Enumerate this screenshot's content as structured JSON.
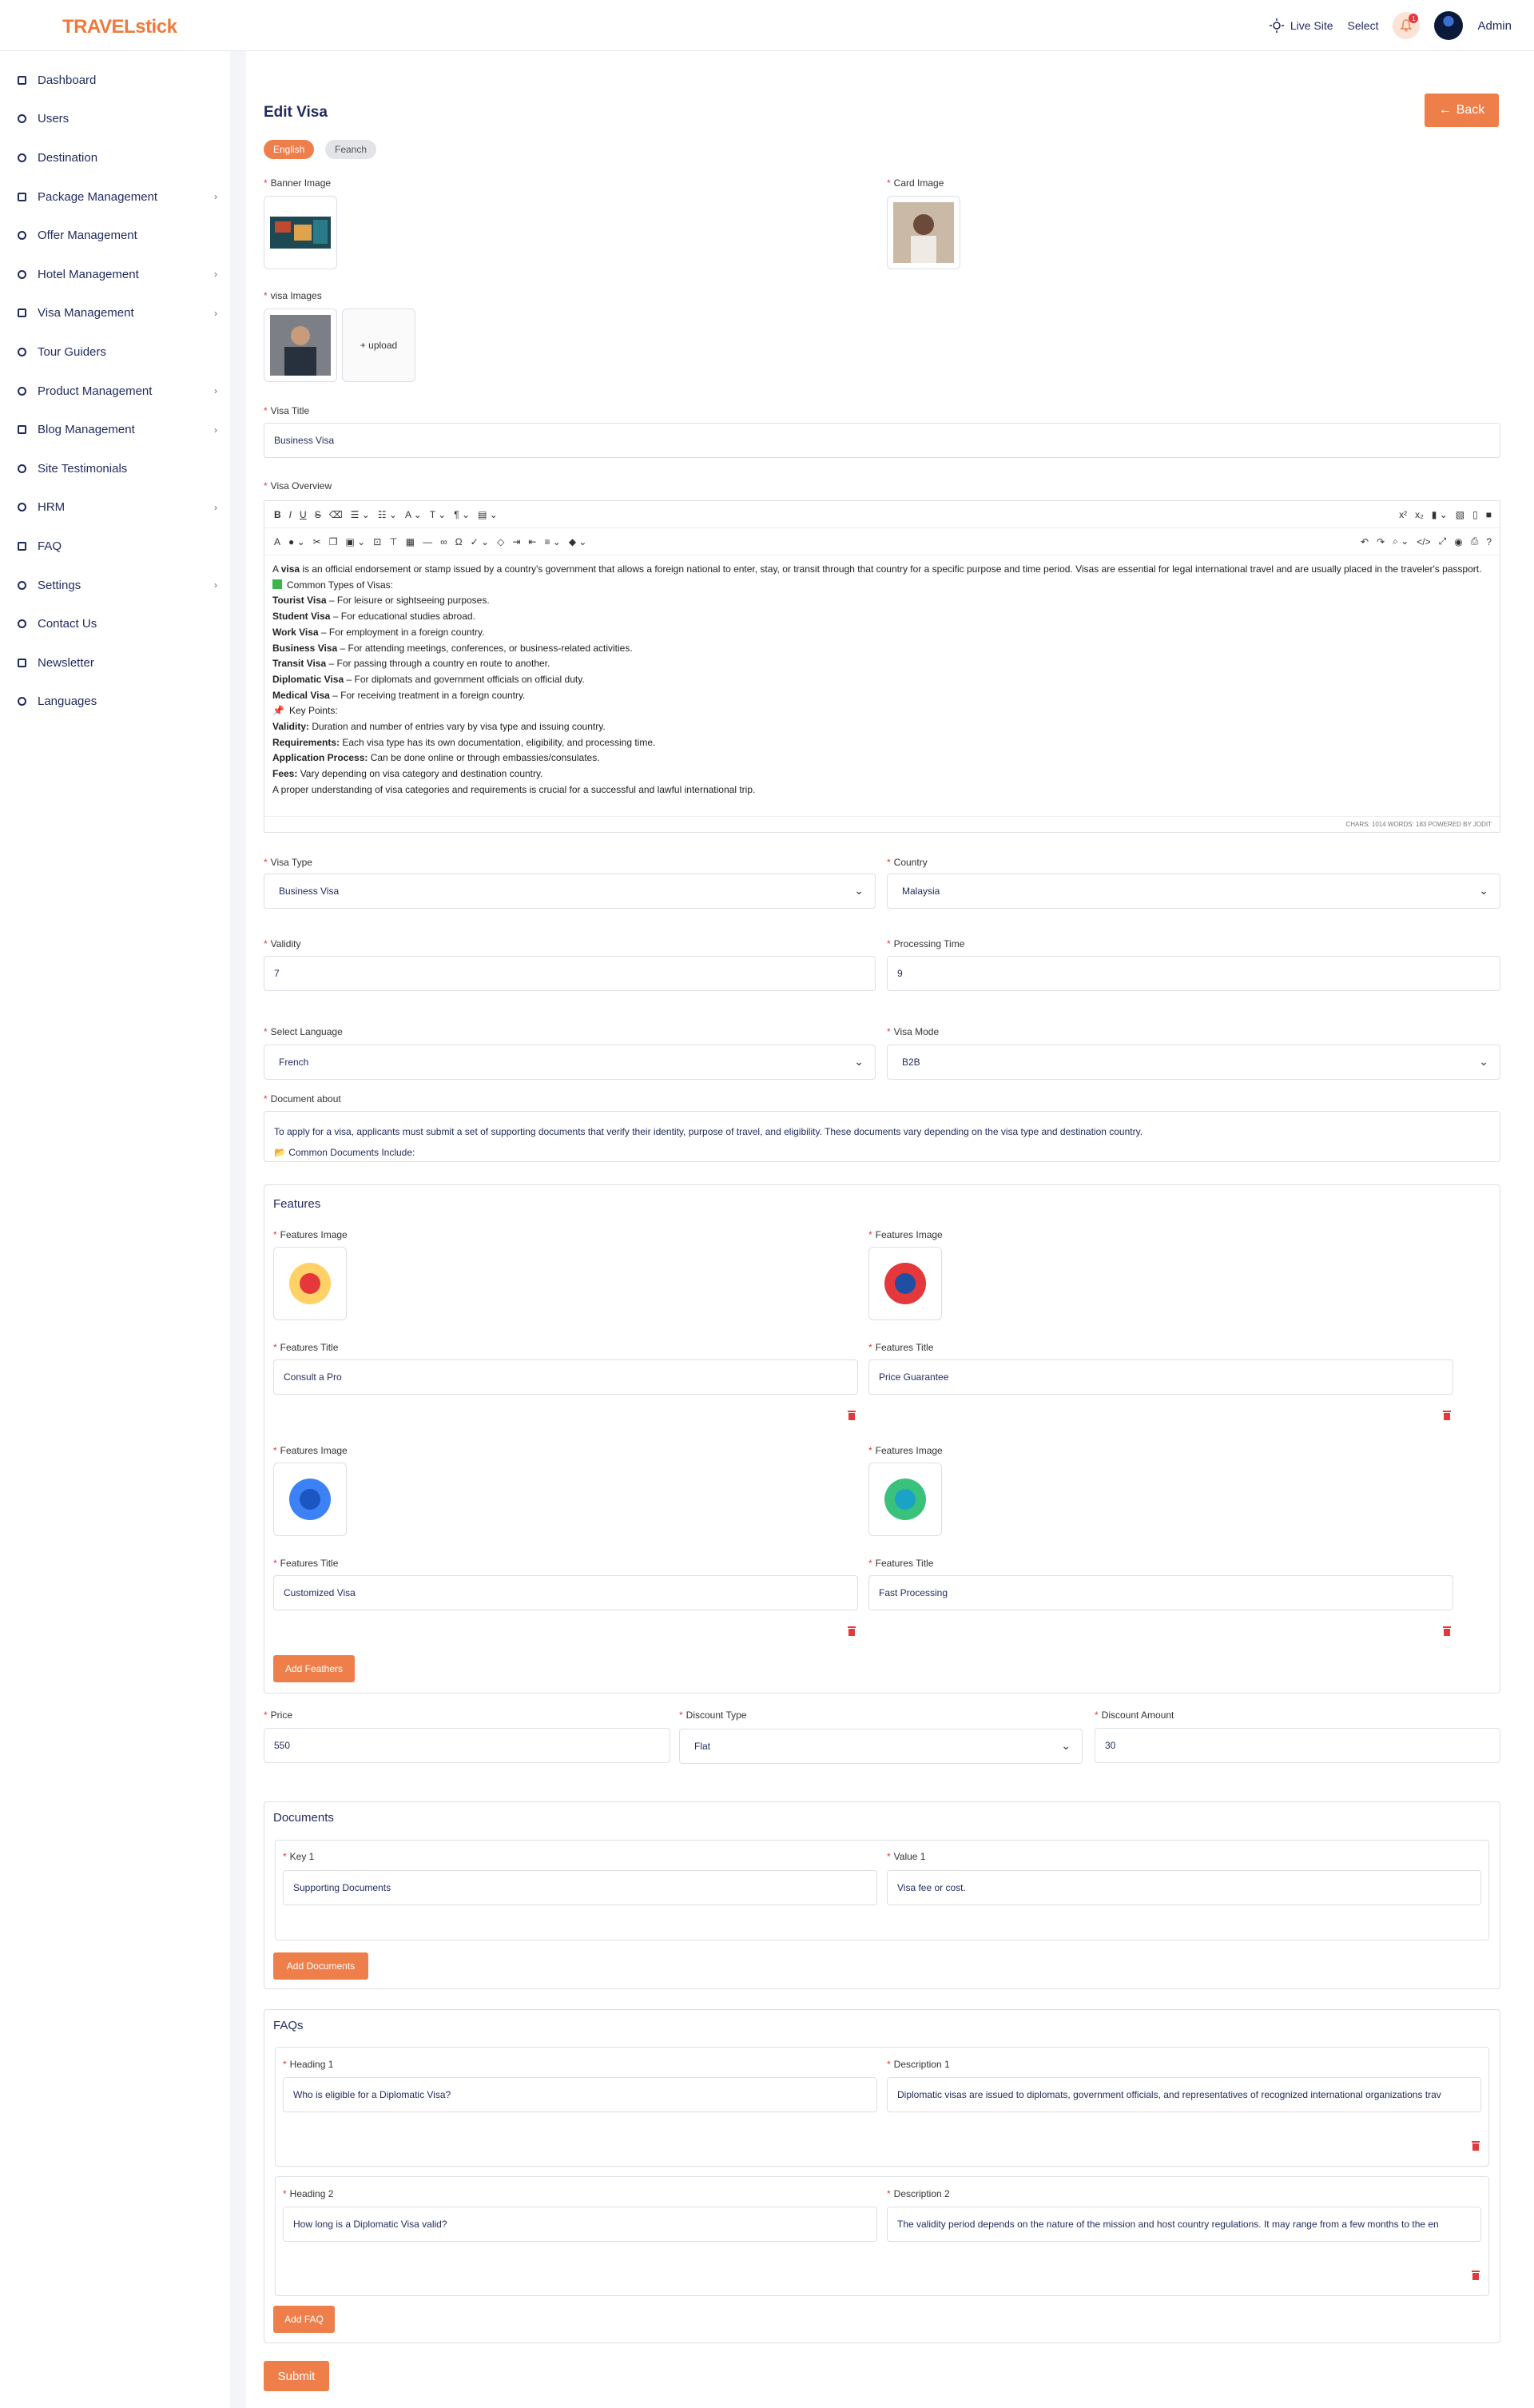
{
  "app": {
    "logo_travel": "TRAVEL",
    "logo_stick": "stick"
  },
  "topbar": {
    "live_site": "Live Site",
    "select": "Select",
    "notif_count": "1",
    "user": "Admin"
  },
  "sidebar": {
    "items": [
      {
        "label": "Dashboard",
        "icon": "dashboard-icon",
        "chevron": false
      },
      {
        "label": "Users",
        "icon": "users-icon",
        "chevron": false
      },
      {
        "label": "Destination",
        "icon": "destination-icon",
        "chevron": false
      },
      {
        "label": "Package Management",
        "icon": "package-icon",
        "chevron": true
      },
      {
        "label": "Offer Management",
        "icon": "offer-icon",
        "chevron": false
      },
      {
        "label": "Hotel Management",
        "icon": "hotel-icon",
        "chevron": true
      },
      {
        "label": "Visa Management",
        "icon": "visa-icon",
        "chevron": true
      },
      {
        "label": "Tour Guiders",
        "icon": "tour-guide-icon",
        "chevron": false
      },
      {
        "label": "Product Management",
        "icon": "product-icon",
        "chevron": true
      },
      {
        "label": "Blog Management",
        "icon": "blog-icon",
        "chevron": true
      },
      {
        "label": "Site Testimonials",
        "icon": "testimonial-icon",
        "chevron": false
      },
      {
        "label": "HRM",
        "icon": "hrm-icon",
        "chevron": true
      },
      {
        "label": "FAQ",
        "icon": "faq-icon",
        "chevron": false
      },
      {
        "label": "Settings",
        "icon": "settings-icon",
        "chevron": true
      },
      {
        "label": "Contact Us",
        "icon": "contact-icon",
        "chevron": false
      },
      {
        "label": "Newsletter",
        "icon": "newsletter-icon",
        "chevron": false
      },
      {
        "label": "Languages",
        "icon": "globe-icon",
        "chevron": false
      }
    ]
  },
  "page": {
    "title": "Edit Visa",
    "back": "Back"
  },
  "langs": [
    "English",
    "Feanch"
  ],
  "form": {
    "banner_image": "Banner Image",
    "card_image": "Card Image",
    "visa_images": "visa Images",
    "upload": "+ upload",
    "visa_title_label": "Visa Title",
    "visa_title": "Business Visa",
    "visa_overview_label": "Visa Overview",
    "visa_type_label": "Visa Type",
    "visa_type": "Business Visa",
    "country_label": "Country",
    "country": "Malaysia",
    "validity_label": "Validity",
    "validity": "7",
    "processing_label": "Processing Time",
    "processing": "9",
    "select_language_label": "Select Language",
    "select_language": "French",
    "visa_mode_label": "Visa Mode",
    "visa_mode": "B2B",
    "document_about_label": "Document about",
    "document_about": "To apply for a visa, applicants must submit a set of supporting documents that verify their identity, purpose of travel, and eligibility. These documents vary depending on the visa type and destination country.",
    "document_about_more": "📂 Common Documents Include:",
    "price_label": "Price",
    "price": "550",
    "discount_type_label": "Discount Type",
    "discount_type": "Flat",
    "discount_amount_label": "Discount Amount",
    "discount_amount": "30",
    "submit": "Submit"
  },
  "overview": {
    "line1_pre": "A ",
    "line1_bold": "visa",
    "line1_post": " is an official endorsement or stamp issued by a country's government that allows a foreign national to enter, stay, or transit through that country for a specific purpose and time period. Visas are essential for legal international travel and are usually placed in the traveler's passport.",
    "common_types": "Common Types of Visas:",
    "types": [
      {
        "b": "Tourist Visa",
        "t": " – For leisure or sightseeing purposes."
      },
      {
        "b": "Student Visa",
        "t": " – For educational studies abroad."
      },
      {
        "b": "Work Visa",
        "t": " – For employment in a foreign country."
      },
      {
        "b": "Business Visa",
        "t": " – For attending meetings, conferences, or business-related activities."
      },
      {
        "b": "Transit Visa",
        "t": " – For passing through a country en route to another."
      },
      {
        "b": "Diplomatic Visa",
        "t": " – For diplomats and government officials on official duty."
      },
      {
        "b": "Medical Visa",
        "t": " – For receiving treatment in a foreign country."
      }
    ],
    "key_points": "Key Points:",
    "points": [
      {
        "b": "Validity:",
        "t": " Duration and number of entries vary by visa type and issuing country."
      },
      {
        "b": "Requirements:",
        "t": " Each visa type has its own documentation, eligibility, and processing time."
      },
      {
        "b": "Application Process:",
        "t": " Can be done online or through embassies/consulates."
      },
      {
        "b": "Fees:",
        "t": " Vary depending on visa category and destination country."
      }
    ],
    "closing": "A proper understanding of visa categories and requirements is crucial for a successful and lawful international trip.",
    "footer": "CHARS: 1014   WORDS: 183   POWERED BY JODIT"
  },
  "features": {
    "title": "Features",
    "image_label": "Features Image",
    "title_label": "Features Title",
    "items": [
      "Consult a Pro",
      "Price Guarantee",
      "Customized Visa",
      "Fast Processing"
    ],
    "add": "Add Feathers"
  },
  "documents": {
    "title": "Documents",
    "key_label": "Key 1",
    "key": "Supporting Documents",
    "value_label": "Value 1",
    "value": "Visa fee or cost.",
    "add": "Add Documents"
  },
  "faqs": {
    "title": "FAQs",
    "items": [
      {
        "heading_label": "Heading 1",
        "heading": "Who is eligible for a Diplomatic Visa?",
        "desc_label": "Description 1",
        "desc": "Diplomatic visas are issued to diplomats, government officials, and representatives of recognized international organizations trav"
      },
      {
        "heading_label": "Heading 2",
        "heading": "How long is a Diplomatic Visa valid?",
        "desc_label": "Description 2",
        "desc": "The validity period depends on the nature of the mission and host country regulations. It may range from a few months to the en"
      }
    ],
    "add": "Add FAQ"
  },
  "colors": {
    "accent": "#ef7f4a",
    "navy": "#1f2a5c",
    "danger": "#e5383b"
  }
}
